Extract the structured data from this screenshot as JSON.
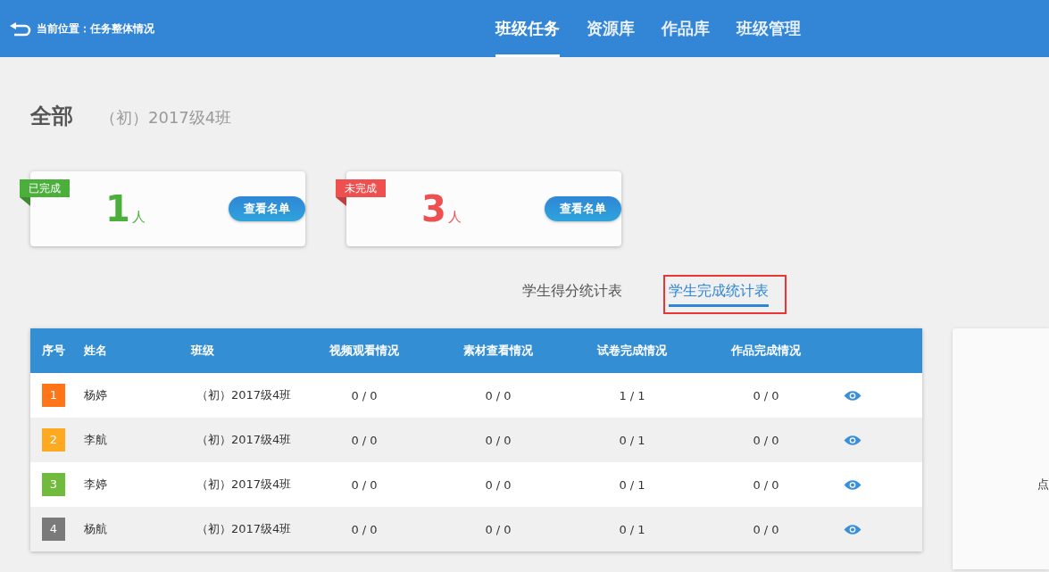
{
  "header": {
    "location": "当前位置：任务整体情况",
    "nav": [
      {
        "label": "班级任务",
        "selected": true
      },
      {
        "label": "资源库",
        "selected": false
      },
      {
        "label": "作品库",
        "selected": false
      },
      {
        "label": "班级管理",
        "selected": false
      }
    ]
  },
  "title": "全部",
  "subtitle": "（初）2017级4班",
  "summary_cards": [
    {
      "tag": "已完成",
      "color": "#4caf3c",
      "count": "1",
      "unit": "人",
      "button": "查看名单"
    },
    {
      "tag": "未完成",
      "color": "#ee4f4f",
      "count": "3",
      "unit": "人",
      "button": "查看名单"
    }
  ],
  "tabs": [
    {
      "label": "学生得分统计表",
      "selected": false,
      "highlighted": false
    },
    {
      "label": "学生完成统计表",
      "selected": true,
      "highlighted": true
    }
  ],
  "table": {
    "columns": [
      "序号",
      "姓名",
      "班级",
      "视频观看情况",
      "素材查看情况",
      "试卷完成情况",
      "作品完成情况"
    ],
    "rows": [
      {
        "rank": "1",
        "color": "#ff7518",
        "name": "杨婷",
        "class": "（初）2017级4班",
        "video": "0 / 0",
        "material": "0 / 0",
        "paper": "1 / 1",
        "work": "0 / 0"
      },
      {
        "rank": "2",
        "color": "#ffa921",
        "name": "李航",
        "class": "（初）2017级4班",
        "video": "0 / 0",
        "material": "0 / 0",
        "paper": "0 / 1",
        "work": "0 / 0"
      },
      {
        "rank": "3",
        "color": "#70bb3e",
        "name": "李婷",
        "class": "（初）2017级4班",
        "video": "0 / 0",
        "material": "0 / 0",
        "paper": "0 / 1",
        "work": "0 / 0"
      },
      {
        "rank": "4",
        "color": "#7a7a7a",
        "name": "杨航",
        "class": "（初）2017级4班",
        "video": "0 / 0",
        "material": "0 / 0",
        "paper": "0 / 1",
        "work": "0 / 0"
      }
    ]
  },
  "side_panel": {
    "text": "点"
  }
}
